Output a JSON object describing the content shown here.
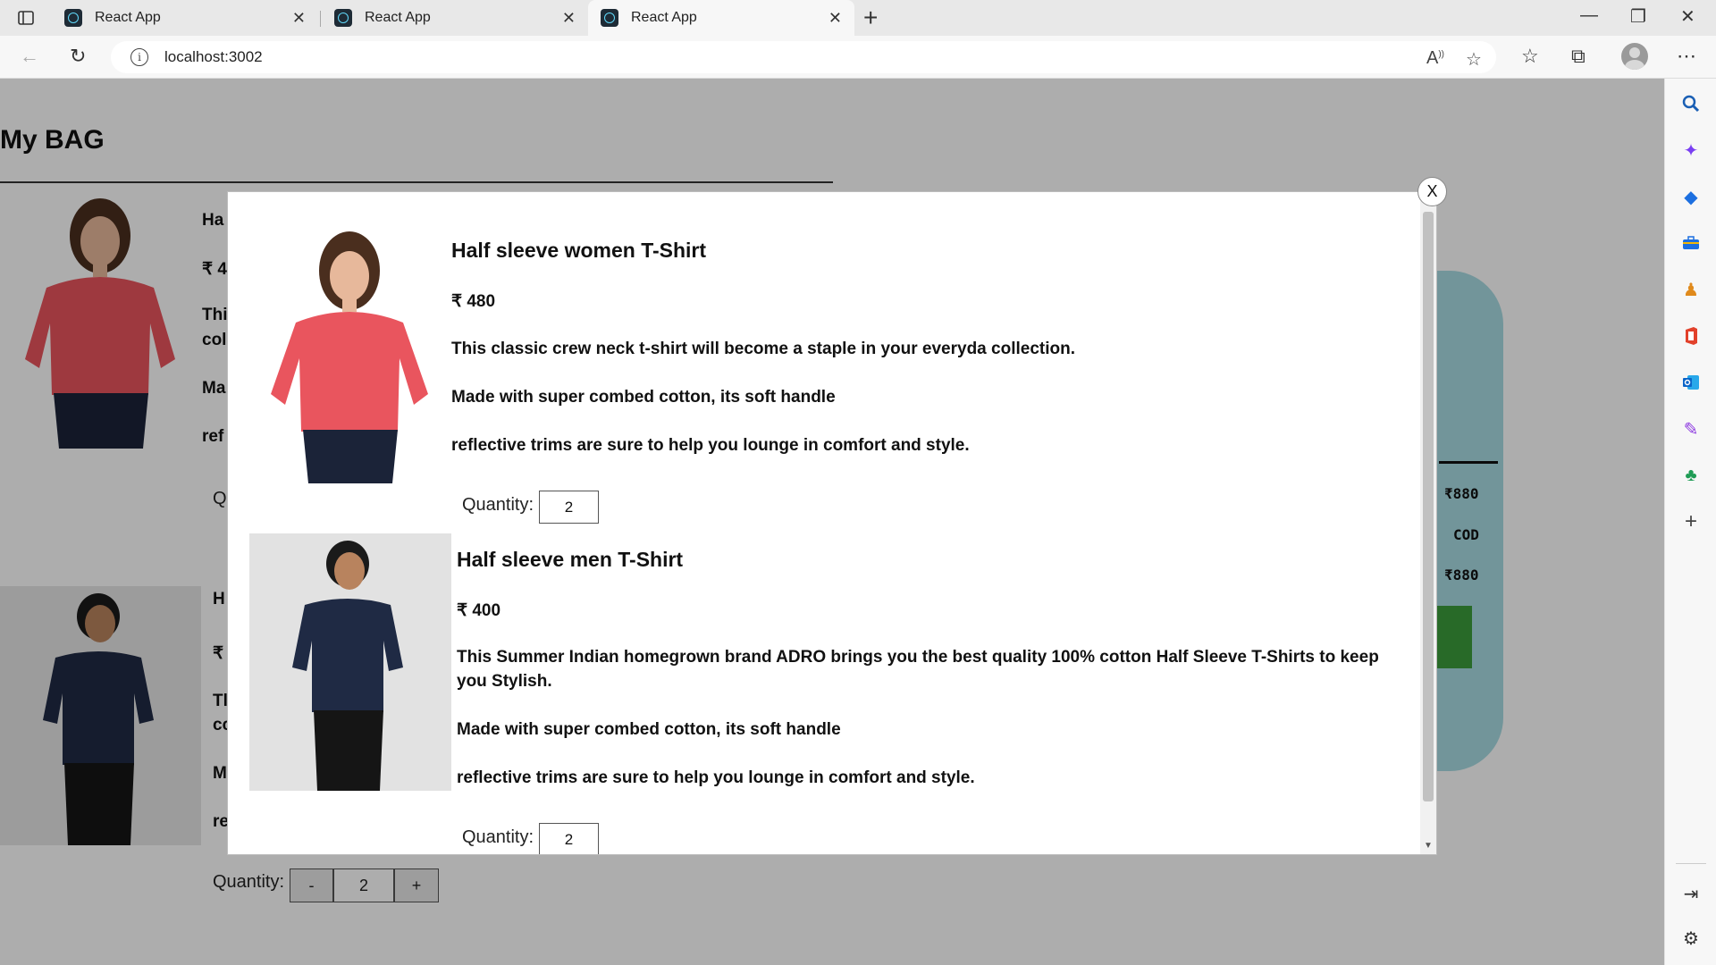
{
  "browser": {
    "tabs": [
      {
        "title": "React App"
      },
      {
        "title": "React App"
      },
      {
        "title": "React App"
      }
    ],
    "url": "localhost:3002"
  },
  "page": {
    "title": "My BAG",
    "bag_items": [
      {
        "title_partial": "Ha",
        "price_partial": "₹ 4",
        "desc1_partial": "Thi",
        "desc1b_partial": "col",
        "desc2_partial": "Ma",
        "desc3_partial": "ref",
        "qty_partial": "Q"
      },
      {
        "title_partial": "H",
        "price_partial": "₹",
        "desc1_partial": "Tl",
        "desc1b_partial": "cc",
        "desc2_partial": "M",
        "desc3_partial": "re"
      }
    ],
    "quantity_label": "Quantity:",
    "minus_label": "-",
    "plus_label": "+",
    "qty_value": "2",
    "summary": {
      "subtotal": "₹880",
      "payment": "COD",
      "total": "₹880"
    }
  },
  "modal": {
    "close_label": "X",
    "items": [
      {
        "title": "Half sleeve women T-Shirt",
        "price": "₹ 480",
        "desc1": "This classic crew neck t-shirt will become a staple in your everyda collection.",
        "desc2": "Made with super combed cotton, its soft handle",
        "desc3": "reflective trims are sure to help you lounge in comfort and style.",
        "quantity_label": "Quantity:",
        "quantity": "2"
      },
      {
        "title": "Half sleeve men T-Shirt",
        "price": "₹ 400",
        "desc1": "This Summer Indian homegrown brand ADRO brings you the best quality 100% cotton Half Sleeve T-Shirts to keep you Stylish.",
        "desc2": "Made with super combed cotton, its soft handle",
        "desc3": "reflective trims are sure to help you lounge in comfort and style.",
        "quantity_label": "Quantity:",
        "quantity": "2"
      }
    ]
  },
  "colors": {
    "summary_card": "#a8dce3",
    "checkout_button": "#3c9c3c",
    "overlay": "rgba(0,0,0,0.32)"
  },
  "icons": [
    "tab-actions-icon",
    "react-favicon",
    "close-icon",
    "new-tab-icon",
    "minimize-icon",
    "maximize-icon",
    "window-close-icon",
    "back-icon",
    "refresh-icon",
    "info-icon",
    "read-aloud-icon",
    "add-favorite-icon",
    "favorites-icon",
    "collections-icon",
    "profile-avatar",
    "more-icon",
    "search-icon",
    "copilot-icon",
    "shopping-icon",
    "tools-icon",
    "games-icon",
    "office-icon",
    "outlook-icon",
    "designer-icon",
    "tree-icon",
    "add-icon",
    "hide-sidebar-icon",
    "settings-icon"
  ]
}
